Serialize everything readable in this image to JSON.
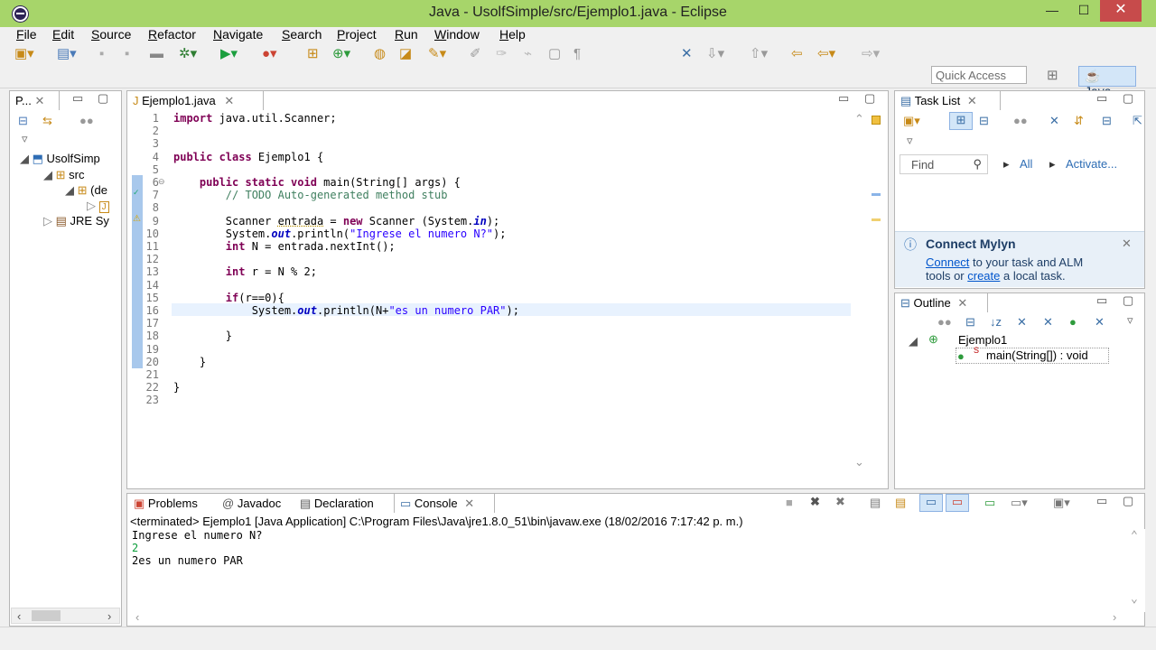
{
  "window": {
    "title": "Java - UsolfSimple/src/Ejemplo1.java - Eclipse",
    "minimize": "—",
    "maximize": "☐",
    "close": "✕"
  },
  "menu": [
    "File",
    "Edit",
    "Source",
    "Refactor",
    "Navigate",
    "Search",
    "Project",
    "Run",
    "Window",
    "Help"
  ],
  "toolbar": {
    "quick_access_placeholder": "Quick Access",
    "perspective": "Java"
  },
  "package_explorer": {
    "tab": "P...",
    "tree": [
      "UsolfSimp",
      "src",
      "(de",
      "",
      "JRE Sy"
    ]
  },
  "editor": {
    "tab": "Ejemplo1.java",
    "lines": [
      {
        "n": "1",
        "html": "<span class=\"kw\">import</span> java.util.Scanner;"
      },
      {
        "n": "2",
        "html": ""
      },
      {
        "n": "3",
        "html": ""
      },
      {
        "n": "4",
        "html": "<span class=\"kw\">public class</span> Ejemplo1 {"
      },
      {
        "n": "5",
        "html": ""
      },
      {
        "n": "6",
        "html": "    <span class=\"kw\">public static void</span> main(String[] args) {"
      },
      {
        "n": "7",
        "html": "        <span class=\"cm\">// TODO Auto-generated method stub</span>"
      },
      {
        "n": "8",
        "html": ""
      },
      {
        "n": "9",
        "html": "        Scanner <span class=\"u\">entrada</span> = <span class=\"kw\">new</span> Scanner (System.<span class=\"fld\">in</span>);"
      },
      {
        "n": "10",
        "html": "        System.<span class=\"fld\">out</span>.println(<span class=\"st\">\"Ingrese el numero N?\"</span>);"
      },
      {
        "n": "11",
        "html": "        <span class=\"kw\">int</span> N = entrada.nextInt();"
      },
      {
        "n": "12",
        "html": ""
      },
      {
        "n": "13",
        "html": "        <span class=\"kw\">int</span> r = N % 2;"
      },
      {
        "n": "14",
        "html": ""
      },
      {
        "n": "15",
        "html": "        <span class=\"kw\">if</span>(r==0){"
      },
      {
        "n": "16",
        "html": "            System.<span class=\"fld\">out</span>.println(N+<span class=\"st\">\"es un numero PAR\"</span>);"
      },
      {
        "n": "17",
        "html": ""
      },
      {
        "n": "18",
        "html": "        }"
      },
      {
        "n": "19",
        "html": ""
      },
      {
        "n": "20",
        "html": "    }"
      },
      {
        "n": "21",
        "html": ""
      },
      {
        "n": "22",
        "html": "}"
      },
      {
        "n": "23",
        "html": ""
      }
    ]
  },
  "task_list": {
    "tab": "Task List",
    "find_placeholder": "Find",
    "all": "All",
    "activate": "Activate...",
    "mylyn_title": "Connect Mylyn",
    "mylyn_connect": "Connect",
    "mylyn_text1": " to your task and ALM",
    "mylyn_text2": "tools or ",
    "mylyn_create": "create",
    "mylyn_text3": " a local task."
  },
  "outline": {
    "tab": "Outline",
    "class": "Ejemplo1",
    "method": "main(String[]) : void",
    "static_marker": "S"
  },
  "bottom_tabs": {
    "problems": "Problems",
    "javadoc": "Javadoc",
    "declaration": "Declaration",
    "console": "Console"
  },
  "console": {
    "header": "<terminated> Ejemplo1 [Java Application] C:\\Program Files\\Java\\jre1.8.0_51\\bin\\javaw.exe (18/02/2016 7:17:42 p. m.)",
    "line1": "Ingrese el numero N?",
    "line2": "2",
    "line3": "2es un numero PAR"
  },
  "colors": {
    "titlebar": "#a7d56a",
    "close": "#c74b4b",
    "keyword": "#7f0055",
    "comment": "#3f7f5f",
    "string": "#2a00ff",
    "input": "#0a9e3a"
  }
}
